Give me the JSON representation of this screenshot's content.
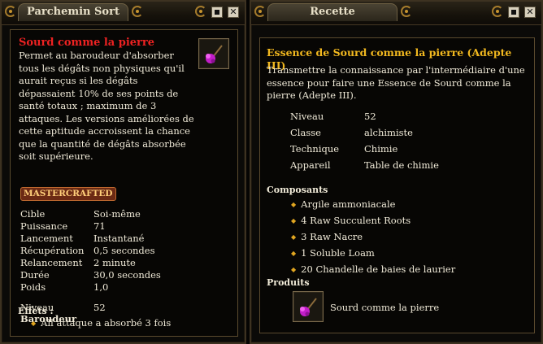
{
  "left_window": {
    "title": "Parchemin Sort",
    "spell_name": "Sourd comme la pierre",
    "description": "Permet au baroudeur d'absorber tous les dégâts non physiques qu'il aurait reçus si les dégâts dépassaient 10% de ses points de santé totaux ; maximum de 3 attaques. Les versions améliorées de cette aptitude accroissent la chance que la quantité de dégâts absorbée soit supérieure.",
    "badge": "MASTERCRAFTED",
    "stats": [
      {
        "label": "Cible",
        "value": "Soi-même"
      },
      {
        "label": "Puissance",
        "value": "71"
      },
      {
        "label": "Lancement",
        "value": "Instantané"
      },
      {
        "label": "Récupération",
        "value": "0,5 secondes"
      },
      {
        "label": "Relancement",
        "value": "2 minute"
      },
      {
        "label": "Durée",
        "value": "30,0 secondes"
      },
      {
        "label": "Poids",
        "value": "1,0"
      }
    ],
    "level_label": "Niveau",
    "level_value": "52",
    "class_name": "Baroudeur",
    "effects_label": "Effets :",
    "effects": [
      "All attaque a absorbé 3 fois"
    ],
    "icon": "magenta-flower-icon"
  },
  "right_window": {
    "title": "Recette",
    "recipe_name": "Essence de Sourd comme la pierre (Adepte III)",
    "description": "Transmettre la connaissance par l'intermédiaire d'une essence pour faire une Essence de Sourd comme la pierre (Adepte III).",
    "details": [
      {
        "label": "Niveau",
        "value": "52"
      },
      {
        "label": "Classe",
        "value": "alchimiste"
      },
      {
        "label": "Technique",
        "value": "Chimie"
      },
      {
        "label": "Appareil",
        "value": "Table de chimie"
      }
    ],
    "components_label": "Composants",
    "components": [
      "Argile ammoniacale",
      "4 Raw Succulent Roots",
      "3 Raw Nacre",
      "1 Soluble Loam",
      "20 Chandelle de baies de laurier"
    ],
    "products_label": "Produits",
    "product_name": "Sourd comme la pierre",
    "icon": "magenta-flower-icon"
  },
  "window_buttons": [
    "minimize-icon",
    "close-icon"
  ],
  "colors": {
    "spell_title": "#ee2222",
    "section_gold": "#f1b81f",
    "body_text": "#f0ead8",
    "frame": "#3d3221"
  }
}
